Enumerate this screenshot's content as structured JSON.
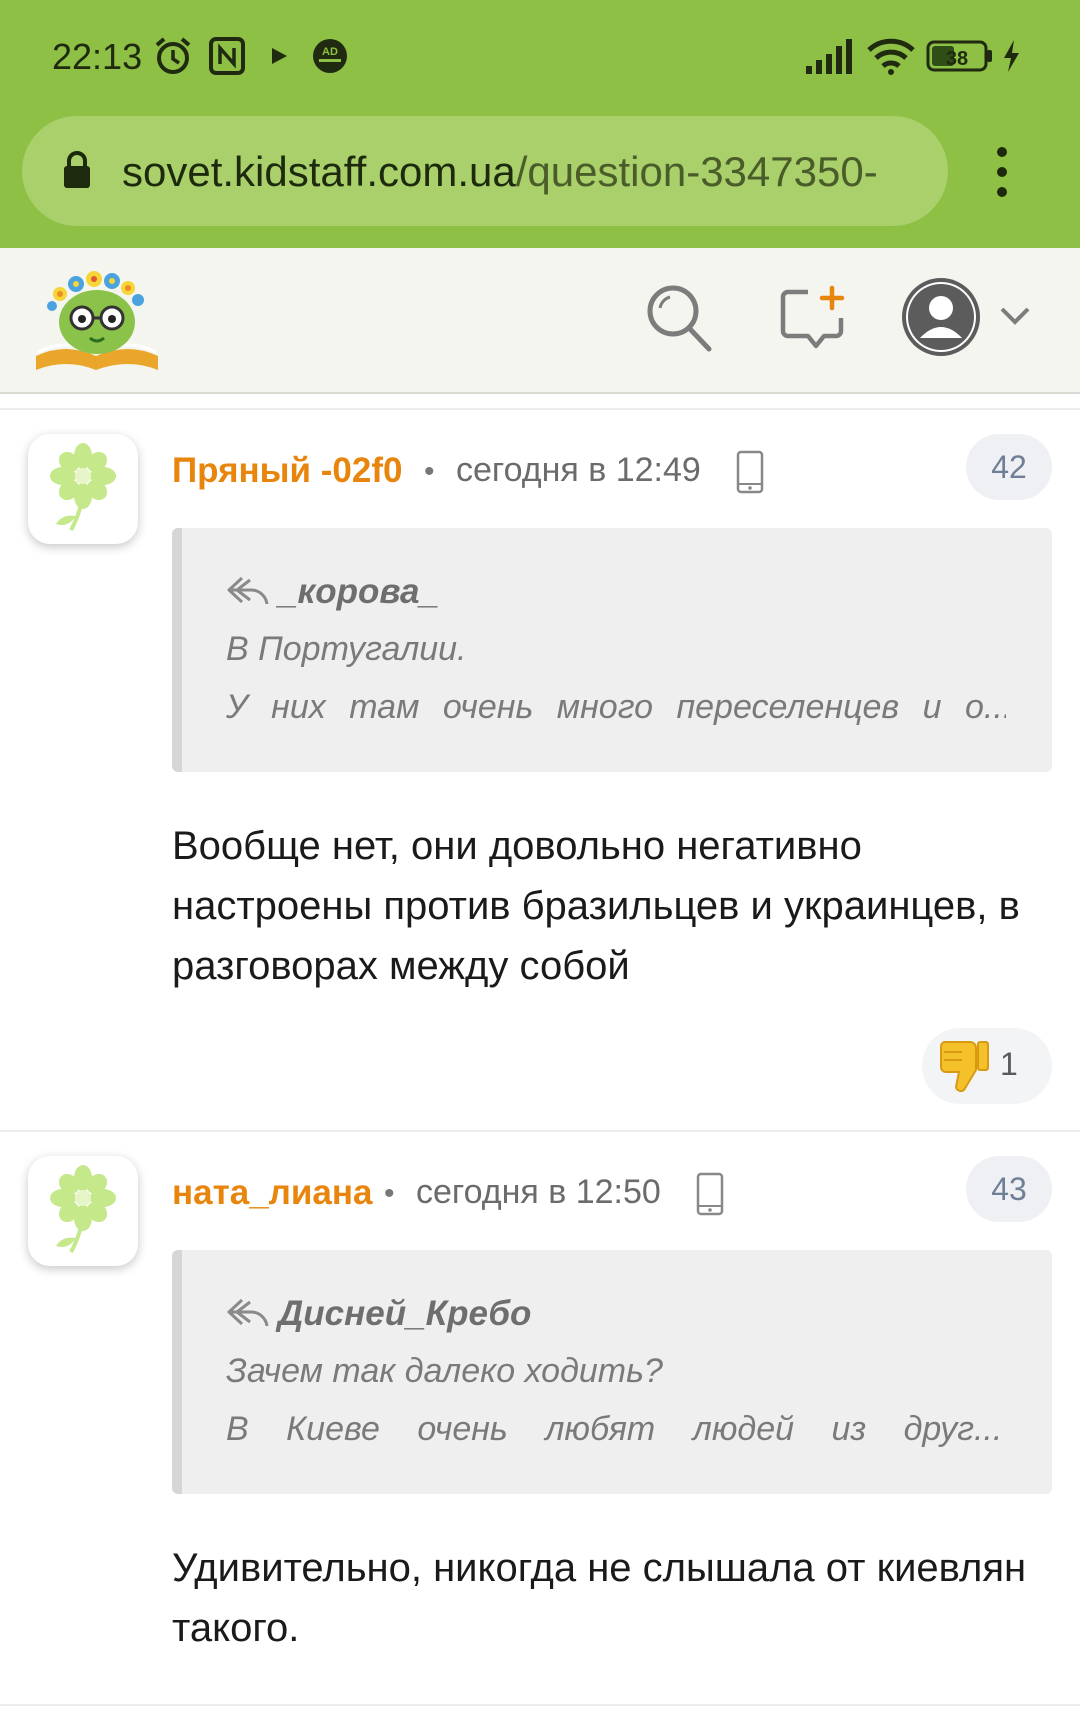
{
  "status_bar": {
    "time": "22:13",
    "icons": [
      "alarm-icon",
      "nfc-icon",
      "play-icon",
      "ad-blocker-icon"
    ],
    "right_icons": [
      "signal-icon",
      "wifi-icon",
      "battery-icon",
      "charging-icon"
    ],
    "battery": "38",
    "ad_badge": "AD"
  },
  "browser": {
    "url_main": "sovet.kidstaff.com.ua",
    "url_path": "/question-3347350-",
    "menu_icon": "more-vert-icon"
  },
  "header": {
    "logo": "kidstaff-logo",
    "icons": [
      "search-icon",
      "new-post-icon",
      "user-avatar-icon",
      "chevron-down-icon"
    ]
  },
  "comments": [
    {
      "author": "Пряный -02f0",
      "separator": "•",
      "time": "сегодня в 12:49",
      "number": "42",
      "quote": {
        "author": "_корова_",
        "lines": [
          "В Португалии.",
          "У них там очень много переселенцев и о..."
        ]
      },
      "text": "Вообще нет, они довольно негативно настроены против бразильцев и украинцев, в разговорах между собой",
      "reaction": {
        "icon": "thumbs-down-icon",
        "count": "1"
      }
    },
    {
      "author": "ната_лиана",
      "separator": "•",
      "time": "сегодня в 12:50",
      "number": "43",
      "quote": {
        "author": "Дисней_Кребо",
        "lines": [
          "Зачем так далеко ходить?",
          "В Киеве очень любят людей из друг..."
        ]
      },
      "text": "Удивительно, никогда не слышала от киевлян такого."
    }
  ],
  "colors": {
    "browser_bar": "#8dc044",
    "author": "#e8850d",
    "header_bg": "#f4f5ef"
  }
}
